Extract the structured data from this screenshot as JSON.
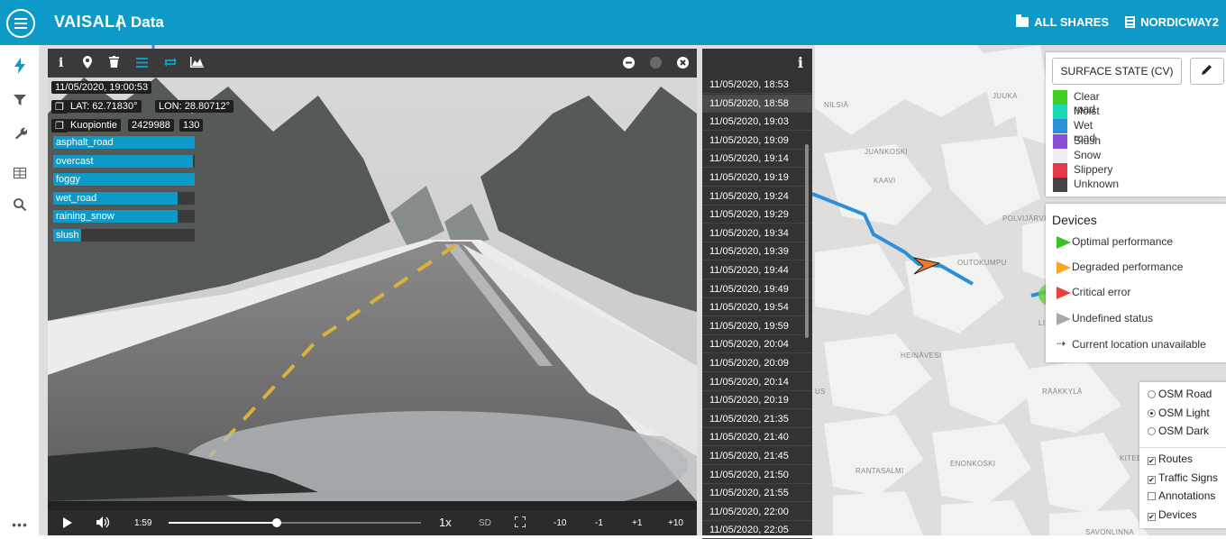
{
  "header": {
    "brand": "VAISALA",
    "separator": "|",
    "app_title": "Data",
    "all_shares": "ALL SHARES",
    "org": "NORDICWAY2"
  },
  "sidebar": {
    "icons": [
      "bolt-icon",
      "filter-icon",
      "wrench-icon",
      "table-icon",
      "search-icon",
      "more-icon"
    ]
  },
  "viewer": {
    "timestamp": "11/05/2020, 19:00:53",
    "lat": "LAT: 62.71830°",
    "lon": "LON: 28.80712°",
    "road": "Kuopiontie",
    "id": "2429988",
    "num": "130",
    "labels": [
      {
        "text": "asphalt_road",
        "level": 1.0
      },
      {
        "text": "overcast",
        "level": 0.99
      },
      {
        "text": "foggy",
        "level": 1.0
      },
      {
        "text": "wet_road",
        "level": 0.88
      },
      {
        "text": "raining_snow",
        "level": 0.88
      },
      {
        "text": "slush",
        "level": 0.2
      }
    ],
    "controls": {
      "time": "1:59",
      "speed": "1x",
      "quality": "SD",
      "jumps": [
        "-10",
        "-1",
        "+1",
        "+10"
      ],
      "progress": 0.43
    }
  },
  "timestamps": [
    "11/05/2020, 18:53",
    "11/05/2020, 18:58",
    "11/05/2020, 19:03",
    "11/05/2020, 19:09",
    "11/05/2020, 19:14",
    "11/05/2020, 19:19",
    "11/05/2020, 19:24",
    "11/05/2020, 19:29",
    "11/05/2020, 19:34",
    "11/05/2020, 19:39",
    "11/05/2020, 19:44",
    "11/05/2020, 19:49",
    "11/05/2020, 19:54",
    "11/05/2020, 19:59",
    "11/05/2020, 20:04",
    "11/05/2020, 20:09",
    "11/05/2020, 20:14",
    "11/05/2020, 20:19",
    "11/05/2020, 21:35",
    "11/05/2020, 21:40",
    "11/05/2020, 21:45",
    "11/05/2020, 21:50",
    "11/05/2020, 21:55",
    "11/05/2020, 22:00",
    "11/05/2020, 22:05"
  ],
  "selected_timestamp_index": 1,
  "legend": {
    "button": "SURFACE STATE (CV)",
    "items": [
      {
        "label": "Clear road",
        "color": "#3fcf22"
      },
      {
        "label": "Moist",
        "color": "#1ad7b6"
      },
      {
        "label": "Wet road",
        "color": "#2e8fd9"
      },
      {
        "label": "Slush",
        "color": "#8a4fd6"
      },
      {
        "label": "Snow",
        "color": "#eeeef3"
      },
      {
        "label": "Slippery",
        "color": "#e23a4a"
      },
      {
        "label": "Unknown",
        "color": "#444444"
      }
    ]
  },
  "devices": {
    "title": "Devices",
    "items": [
      {
        "label": "Optimal performance",
        "color": "#3bbf2a"
      },
      {
        "label": "Degraded performance",
        "color": "#f5a623"
      },
      {
        "label": "Critical error",
        "color": "#e8413e"
      },
      {
        "label": "Undefined status",
        "color": "#aaaaaa"
      }
    ],
    "unavailable": "Current location unavailable"
  },
  "layers": {
    "base": [
      {
        "label": "OSM Road",
        "selected": false
      },
      {
        "label": "OSM Light",
        "selected": true
      },
      {
        "label": "OSM Dark",
        "selected": false
      }
    ],
    "overlays": [
      {
        "label": "Routes",
        "checked": true
      },
      {
        "label": "Traffic Signs",
        "checked": true
      },
      {
        "label": "Annotations",
        "checked": false
      },
      {
        "label": "Devices",
        "checked": true
      }
    ]
  },
  "map_labels": [
    "NILSIÄ",
    "JUUKA",
    "JUANKOSKI",
    "KAAVI",
    "POLVIJÄRVI",
    "OUTOKUMPU",
    "LIPERI",
    "HEINÄVESI",
    "RÄÄKKYLÄ",
    "RANTASALMI",
    "ENONKOSKI",
    "KITEE",
    "SAVONLINNA",
    "US"
  ]
}
